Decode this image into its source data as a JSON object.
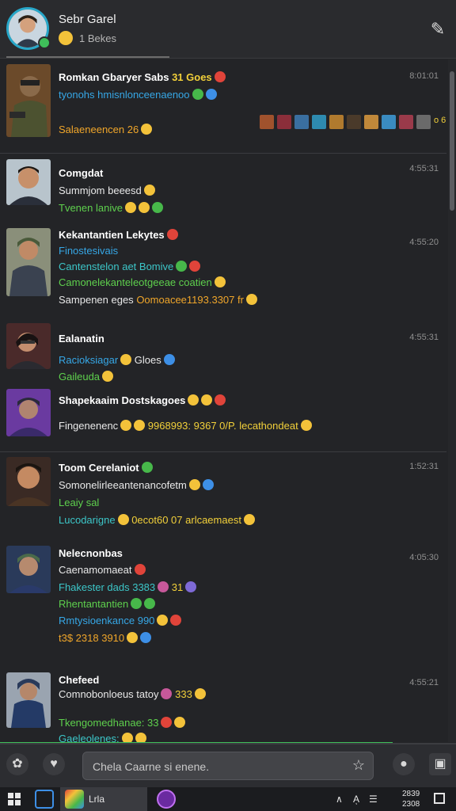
{
  "header": {
    "name": "Sebr Garel",
    "subtitle": "1 Bekes"
  },
  "composer": {
    "placeholder": "Chela Caarne si enene."
  },
  "taskbar": {
    "app_label": "Lrla",
    "tray": [
      "∧",
      "Aͅ",
      "☰"
    ],
    "clock_time": "2839",
    "clock_date": "2308"
  },
  "colors": {
    "accent": "#27a7c9",
    "online": "#3fbf5a",
    "background": "#232427"
  },
  "chats": [
    {
      "timestamp": "8:01:01",
      "lines": [
        {
          "text": "Romkan Gbaryer Sabs",
          "suffix": "31 Goes"
        },
        {
          "text": "tyonohs hmisnlonceenaenoo"
        },
        {
          "text": "Salaeneencen 26",
          "trail": "o 6"
        }
      ]
    },
    {
      "timestamp": "4:55:31",
      "lines": [
        {
          "text": "Comgdat"
        },
        {
          "text": "Summjom beeesd"
        },
        {
          "text": "Tvenen lanive"
        }
      ]
    },
    {
      "timestamp": "4:55:20",
      "lines": [
        {
          "text": "Kekantantien Lekytes"
        },
        {
          "text": "Finostesivais"
        },
        {
          "text": "Cantenstelon aet Bomive"
        },
        {
          "text": "Camonelekanteleotgeeae coatien"
        },
        {
          "text": "Sampenen eges",
          "suffix": "Oomoacee1193.3307 fr"
        }
      ]
    },
    {
      "timestamp": "4:55:31",
      "lines": [
        {
          "text": "Ealanatin"
        },
        {
          "text": "Racioksiagar",
          "suffix": "Gloes"
        },
        {
          "text": "Gaileuda"
        }
      ]
    },
    {
      "timestamp": "",
      "lines": [
        {
          "text": "Shapekaaim Dostskagoes"
        },
        {
          "text": "Fingenenenc",
          "suffix": "9968993:  9367 0/P.  lecathondeat"
        }
      ]
    },
    {
      "timestamp": "1:52:31",
      "lines": [
        {
          "text": "Toom Cerelaniot"
        },
        {
          "text": "Somonelirleeantenancofetm"
        },
        {
          "text": "Leaiy sal"
        },
        {
          "text": "Lucodarigne",
          "suffix": "0ecot60 07  arlcaemaest"
        }
      ]
    },
    {
      "timestamp": "4:05:30",
      "lines": [
        {
          "text": "Nelecnonbas"
        },
        {
          "text": "Caenamomaeat"
        },
        {
          "text": "Fhakester dads 3383",
          "suffix": "31"
        },
        {
          "text": "Rhentantantien"
        },
        {
          "text": "Rmtysioenkance 990"
        },
        {
          "text": "t3$ 2318 3910"
        }
      ]
    },
    {
      "timestamp": "4:55:21",
      "lines": [
        {
          "text": "Chefeed"
        },
        {
          "text": "Comnobonloeus tatoy",
          "suffix": "333"
        },
        {
          "text": "Tkengomedhanae: 33"
        },
        {
          "text": "Gaeleolenes:"
        }
      ]
    }
  ]
}
